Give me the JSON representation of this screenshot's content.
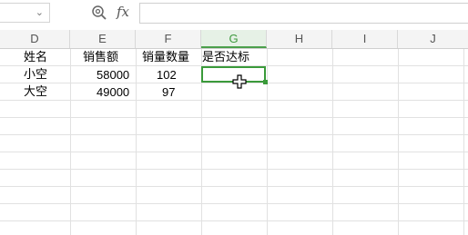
{
  "formula_bar": {
    "fx_label": "fx",
    "formula_value": ""
  },
  "columns": [
    "D",
    "E",
    "F",
    "G",
    "H",
    "I",
    "J"
  ],
  "active_column": "G",
  "headers": [
    "姓名",
    "销售额",
    "销量数量",
    "是否达标"
  ],
  "rows": [
    {
      "name": "小空",
      "sales": "58000",
      "qty": "102",
      "pass": ""
    },
    {
      "name": "大空",
      "sales": "49000",
      "qty": "97",
      "pass": ""
    }
  ],
  "accent_color": "#3a9a3a"
}
